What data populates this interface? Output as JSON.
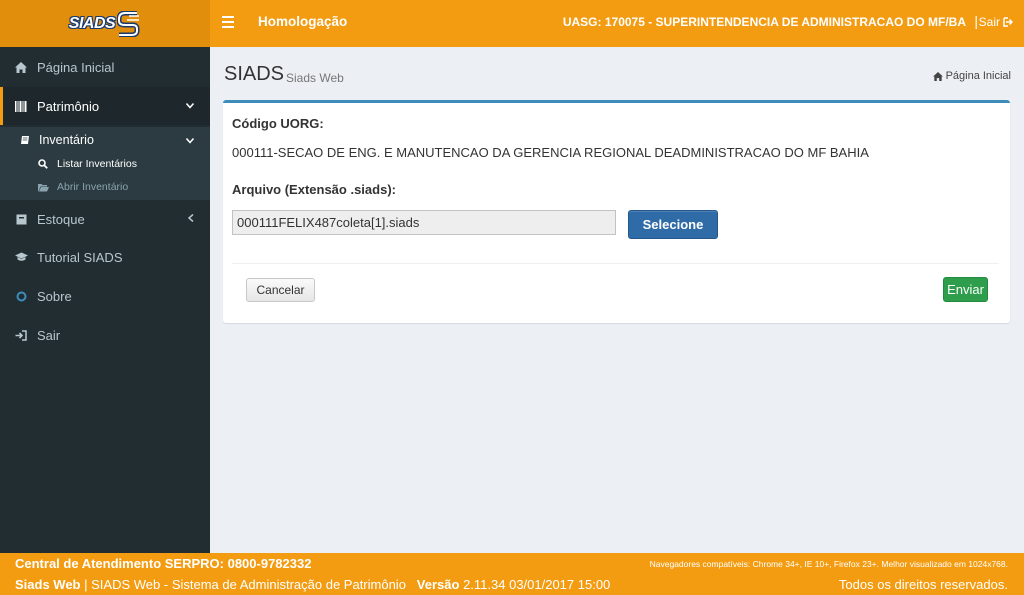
{
  "header": {
    "logo_text": "SIADS",
    "environment": "Homologação",
    "uasg": "UASG: 170075 - SUPERINTENDENCIA DE ADMINISTRACAO DO MF/BA",
    "separator": "|",
    "logout_label": "Sair",
    "bg_color": "#f39c12"
  },
  "sidebar": {
    "items": [
      {
        "label": "Página Inicial",
        "icon": "home-icon"
      },
      {
        "label": "Patrimônio",
        "icon": "barcode-icon"
      },
      {
        "label": "Estoque",
        "icon": "box-icon"
      },
      {
        "label": "Tutorial SIADS",
        "icon": "graduation-cap-icon"
      },
      {
        "label": "Sobre",
        "icon": "circle-icon"
      },
      {
        "label": "Sair",
        "icon": "sign-in-icon"
      }
    ],
    "inventario": {
      "label": "Inventário",
      "sub": [
        {
          "label": "Listar Inventários",
          "icon": "search-icon"
        },
        {
          "label": "Abrir Inventário",
          "icon": "folder-open-icon"
        }
      ]
    }
  },
  "page": {
    "title": "SIADS",
    "subtitle": "Siads Web",
    "breadcrumb": "Página Inicial"
  },
  "form": {
    "uorg_label": "Código UORG:",
    "uorg_value": "000111-SECAO DE ENG. E MANUTENCAO DA GERENCIA REGIONAL DEADMINISTRACAO DO MF BAHIA",
    "file_label": "Arquivo (Extensão .siads):",
    "file_value": "000111FELIX487coleta[1].siads",
    "select_button": "Selecione",
    "cancel_button": "Cancelar",
    "send_button": "Enviar"
  },
  "footer": {
    "central": "Central de Atendimento SERPRO: 0800-9782332",
    "browsers": "Navegadores compatíveis: Chrome 34+, IE 10+, Firefox 23+. Melhor visualizado em 1024x768.",
    "app_name": "Siads Web",
    "app_desc": "SIADS Web - Sistema de Administração de Patrimônio",
    "version_label": "Versão",
    "version_value": "2.11.34 03/01/2017 15:00",
    "rights": "Todos os direitos reservados."
  }
}
